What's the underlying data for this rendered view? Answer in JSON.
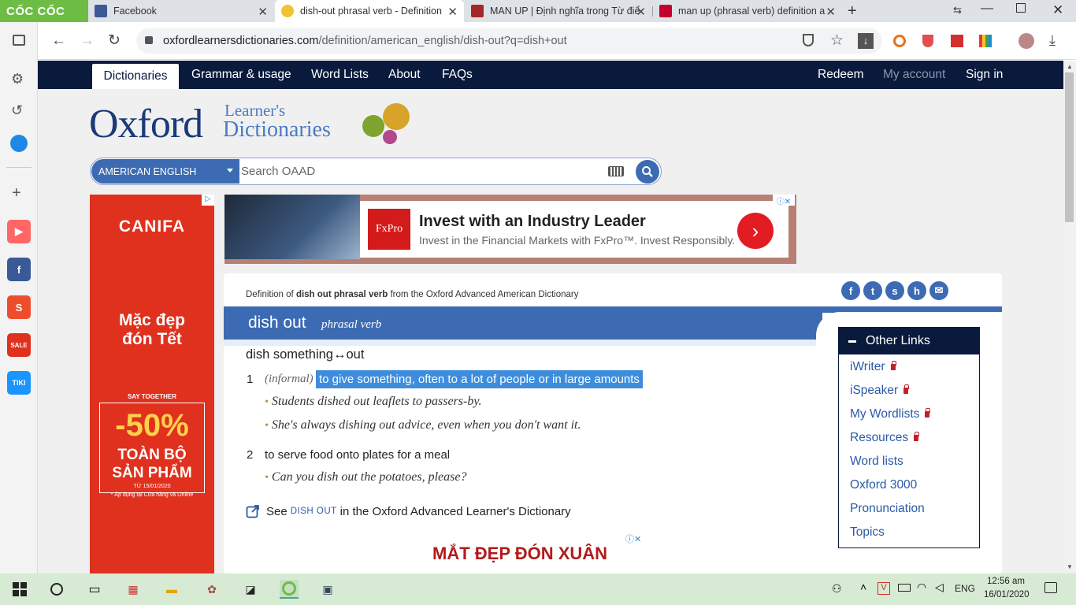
{
  "browser": {
    "brand": "CỐC CỐC",
    "tabs": [
      {
        "title": "Facebook",
        "active": false
      },
      {
        "title": "dish-out phrasal verb - Definition,",
        "active": true
      },
      {
        "title": "MAN UP | Định nghĩa trong Từ điể",
        "active": false
      },
      {
        "title": "man up (phrasal verb) definition a",
        "active": false
      }
    ],
    "url_host": "oxfordlearnersdictionaries.com",
    "url_path": "/definition/american_english/dish-out?q=dish+out"
  },
  "nav": {
    "items": [
      "Dictionaries",
      "Grammar & usage",
      "Word Lists",
      "About",
      "FAQs"
    ],
    "right": [
      "Redeem",
      "My account",
      "Sign in"
    ]
  },
  "logo": {
    "main": "Oxford",
    "line1": "Learner's",
    "line2": "Dictionaries"
  },
  "search": {
    "language": "AMERICAN ENGLISH",
    "placeholder": "Search OAAD"
  },
  "ad_left": {
    "brand": "CANIFA",
    "line1": "Mặc đẹp",
    "line2": "đón Tết",
    "say": "SAY TOGETHER",
    "discount": "-50%",
    "line3": "TOÀN BỘ",
    "line4": "SẢN PHẨM",
    "date": "TỪ 15/01/2020",
    "note": "* Áp dụng tại Cửa hàng và Online"
  },
  "ad_top": {
    "logo": "FxPro",
    "headline": "Invest with an Industry Leader",
    "sub": "Invest in the Financial Markets with FxPro™. Invest Responsibly."
  },
  "entry": {
    "source_prefix": "Definition of ",
    "source_bold": "dish out phrasal verb",
    "source_suffix": " from the Oxford Advanced American Dictionary",
    "headword": "dish out",
    "pos": "phrasal verb",
    "phrase": "dish something↔out",
    "senses": [
      {
        "num": "1",
        "register": "(informal)",
        "def": "to give something, often to a lot of people or in large amounts",
        "examples": [
          "Students dished out leaflets to passers-by.",
          "She's always dishing out advice, even when you don't want it."
        ]
      },
      {
        "num": "2",
        "def": "to serve food onto plates for a meal",
        "examples": [
          "Can you dish out the potatoes, please?"
        ]
      }
    ],
    "see_prefix": "See",
    "see_link": "DISH OUT",
    "see_suffix": "in the Oxford Advanced Learner's Dictionary"
  },
  "other_links": {
    "title": "Other Links",
    "items": [
      "iWriter",
      "iSpeaker",
      "My Wordlists",
      "Resources",
      "Word lists",
      "Oxford 3000",
      "Pronunciation",
      "Topics"
    ]
  },
  "ad_bottom": {
    "text": "MẮT ĐẸP ĐÓN XUÂN"
  },
  "taskbar": {
    "lang": "ENG",
    "time": "12:56 am",
    "date": "16/01/2020"
  },
  "colors": {
    "oxford_navy": "#0a1a3c",
    "entry_blue": "#3d6bb3",
    "highlight": "#3d8ddc",
    "ad_red": "#e0301e"
  }
}
